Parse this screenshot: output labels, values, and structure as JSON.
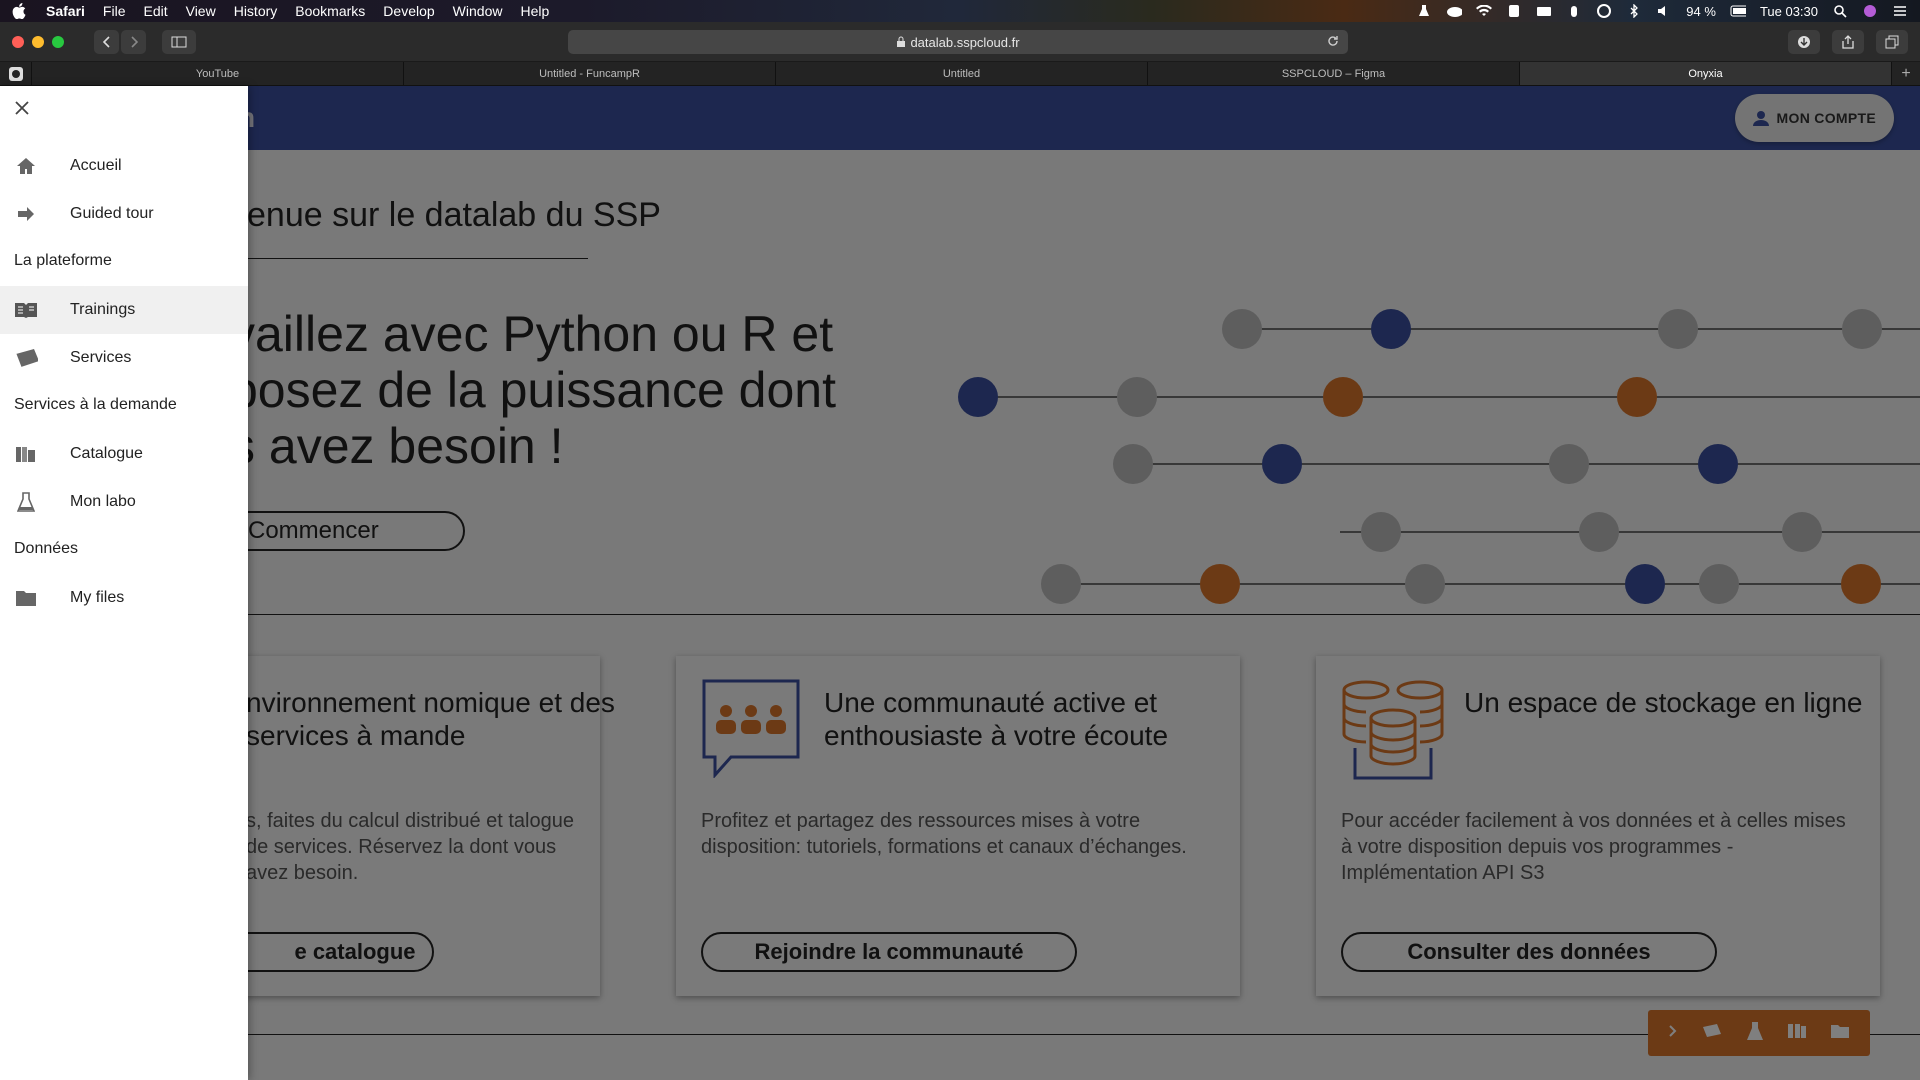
{
  "menubar": {
    "app": "Safari",
    "items": [
      "File",
      "Edit",
      "View",
      "History",
      "Bookmarks",
      "Develop",
      "Window",
      "Help"
    ],
    "battery": "94 %",
    "clock": "Tue 03:30"
  },
  "browser": {
    "url": "datalab.sspcloud.fr",
    "tabs": [
      "YouTube",
      "Untitled - FuncampR",
      "Untitled",
      "SSPCLOUD – Figma",
      "Onyxia"
    ],
    "active_tab": "Onyxia"
  },
  "header": {
    "account_label": "MON COMPTE"
  },
  "hero": {
    "title": "venue sur le datalab du SSP",
    "text": "vaillez avec Python ou R et posez de la puissance dont s avez besoin !",
    "cta": "Commencer"
  },
  "cards": [
    {
      "title": "nvironnement nomique et des services à mande",
      "body": "s, faites du calcul distribué et talogue de services. Réservez la dont vous avez besoin.",
      "cta": "e catalogue"
    },
    {
      "title": "Une communauté active et enthousiaste à votre écoute",
      "body": "Profitez et partagez des ressources mises à votre disposition: tutoriels, formations et canaux d’échanges.",
      "cta": "Rejoindre la communauté"
    },
    {
      "title": "Un espace de stockage en ligne",
      "body": "Pour accéder facilement à vos données et à celles mises à votre disposition depuis vos programmes - Implémentation API S3",
      "cta": "Consulter des données"
    }
  ],
  "drawer": {
    "items": [
      {
        "label": "Accueil",
        "icon": "home-icon"
      },
      {
        "label": "Guided tour",
        "icon": "arrow-right-icon"
      }
    ],
    "section_platform": "La plateforme",
    "platform_items": [
      {
        "label": "Trainings",
        "icon": "book-icon",
        "selected": true
      },
      {
        "label": "Services",
        "icon": "cards-icon",
        "selected": false
      }
    ],
    "section_services": "Services à la demande",
    "services_items": [
      {
        "label": "Catalogue",
        "icon": "catalogue-icon"
      },
      {
        "label": "Mon labo",
        "icon": "flask-icon"
      }
    ],
    "section_data": "Données",
    "data_items": [
      {
        "label": "My files",
        "icon": "folder-icon"
      }
    ]
  },
  "colors": {
    "primary": "#3a4f9e",
    "accent": "#d9752a",
    "dot_gray": "#bcbcbc"
  }
}
